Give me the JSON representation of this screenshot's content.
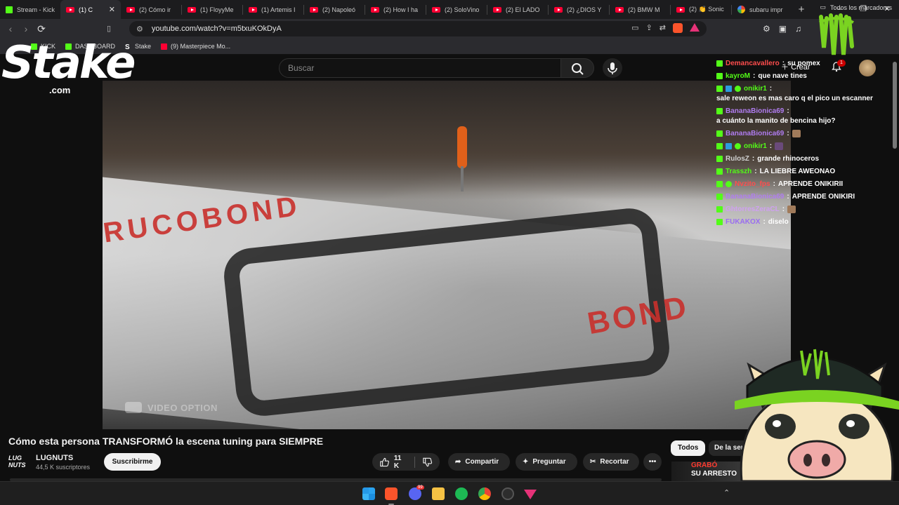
{
  "browser": {
    "tabs": [
      {
        "label": "Stream - Kick",
        "icon": "kick-icon"
      },
      {
        "label": "(1) C",
        "icon": "youtube-icon",
        "active": true,
        "close": "✕"
      },
      {
        "label": "(2) Cómo ir",
        "icon": "youtube-icon"
      },
      {
        "label": "(1) FloyyMe",
        "icon": "youtube-icon"
      },
      {
        "label": "(1) Artemis I",
        "icon": "youtube-icon"
      },
      {
        "label": "(2) Napoleó",
        "icon": "youtube-icon"
      },
      {
        "label": "(2) How I ha",
        "icon": "youtube-icon"
      },
      {
        "label": "(2) SoloVino",
        "icon": "youtube-icon"
      },
      {
        "label": "(2) El LADO",
        "icon": "youtube-icon"
      },
      {
        "label": "(2) ¿DIOS Y",
        "icon": "youtube-icon"
      },
      {
        "label": "(2) BMW M",
        "icon": "youtube-icon"
      },
      {
        "label": "(2) 👏 Sonic",
        "icon": "youtube-icon"
      },
      {
        "label": "subaru impr",
        "icon": "google-icon"
      }
    ],
    "new_tab": "+",
    "window_controls": {
      "minimize": "–",
      "restore": "❐",
      "close": "✕"
    },
    "url": "youtube.com/watch?v=m5txuKOkDyA",
    "bookmarks": [
      {
        "label": "KICK",
        "icon": "kick-icon"
      },
      {
        "label": "DASHBOARD",
        "icon": "kick-icon"
      },
      {
        "label": "Stake",
        "icon": "stake-icon"
      },
      {
        "label": "(9) Masterpiece Mo...",
        "icon": "youtube-icon"
      }
    ],
    "all_bookmarks": "Todos los marcadores"
  },
  "youtube": {
    "search_placeholder": "Buscar",
    "create_label": "Crear",
    "notifications_count": "1",
    "video_watermark": "VIDEO OPTION",
    "video_title": "Cómo esta persona TRANSFORMÓ la escena tuning para SIEMPRE",
    "channel": {
      "name": "LUGNUTS",
      "subscribers": "44,5 K suscriptores",
      "logo_text": "LUG NUTS"
    },
    "subscribe_label": "Suscribirme",
    "likes": "11 K",
    "share_label": "Compartir",
    "ask_label": "Preguntar",
    "clip_label": "Recortar",
    "chips": [
      "Todos",
      "De la serie"
    ],
    "thumb_text_1": "GRABÓ",
    "thumb_text_2": "SU ARRESTO"
  },
  "overlay": {
    "stake_logo": "Stake",
    "stake_domain": ".com",
    "chat": [
      {
        "user": "Demancavallero",
        "color": "#ff4d4d",
        "text": "su pomex",
        "badges": [
          "k"
        ]
      },
      {
        "user": "kayroM",
        "color": "#53fc18",
        "text": "que nave tines",
        "badges": [
          "k"
        ]
      },
      {
        "user": "onikir1",
        "color": "#53fc18",
        "text": "sale reweon es mas caro q el pico un escanner",
        "badges": [
          "k",
          "b2",
          "b3"
        ]
      },
      {
        "user": "BananaBionica69",
        "color": "#b07cf0",
        "text": "a cuánto la manito de bencina hijo?",
        "badges": [
          "k"
        ]
      },
      {
        "user": "BananaBionica69",
        "color": "#b07cf0",
        "text": "",
        "badges": [
          "k"
        ],
        "emote": true
      },
      {
        "user": "onikir1",
        "color": "#53fc18",
        "text": "",
        "badges": [
          "k",
          "b2",
          "b3"
        ],
        "emote": true
      },
      {
        "user": "RulosZ",
        "color": "#d0d0d0",
        "text": "grande rhinoceros",
        "badges": [
          "k"
        ]
      },
      {
        "user": "Trasszh",
        "color": "#53fc18",
        "text": "LA LIEBRE AWEONAO",
        "badges": [
          "k"
        ]
      },
      {
        "user": "Nvzito_fps",
        "color": "#ff4d4d",
        "text": "APRENDE ONIKIRII",
        "badges": [
          "k",
          "b3"
        ]
      },
      {
        "user": "BananaBionica69",
        "color": "#b07cf0",
        "text": "APRENDE ONIKIRI",
        "badges": [
          "k"
        ]
      },
      {
        "user": "GhtorresZeraCL",
        "color": "#cfa0f0",
        "text": "",
        "badges": [
          "k"
        ],
        "emote": true
      },
      {
        "user": "FUKAKOX",
        "color": "#9a6df0",
        "text": "diselo",
        "badges": [
          "k"
        ]
      }
    ]
  },
  "taskbar": {
    "apps": [
      "windows-start",
      "brave",
      "discord",
      "file-explorer",
      "spotify",
      "chrome",
      "obs",
      "brave-triangle"
    ],
    "discord_badge": "99"
  }
}
